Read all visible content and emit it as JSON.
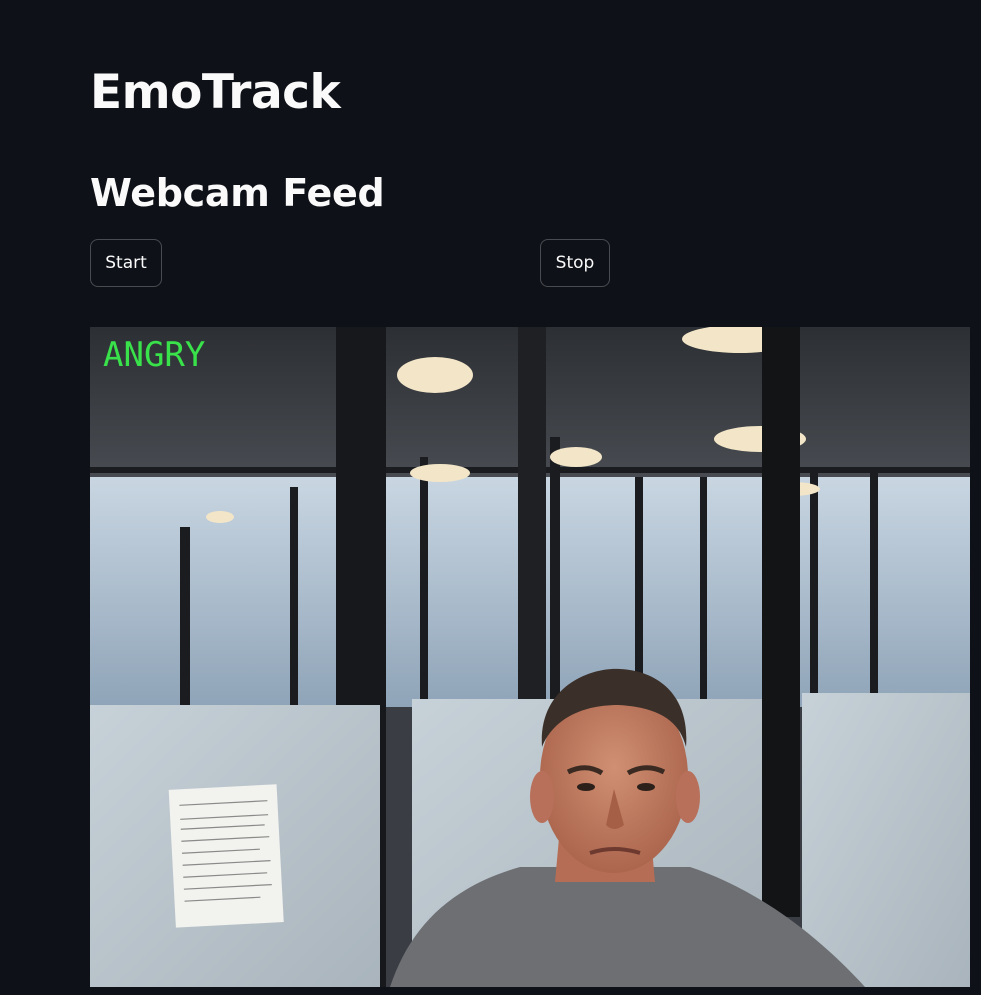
{
  "app": {
    "title": "EmoTrack"
  },
  "section": {
    "title": "Webcam Feed"
  },
  "controls": {
    "start_label": "Start",
    "stop_label": "Stop"
  },
  "feed": {
    "detected_emotion": "ANGRY",
    "label_color": "#39e24a"
  },
  "theme": {
    "background": "#0e1117",
    "text": "#fafafa"
  }
}
